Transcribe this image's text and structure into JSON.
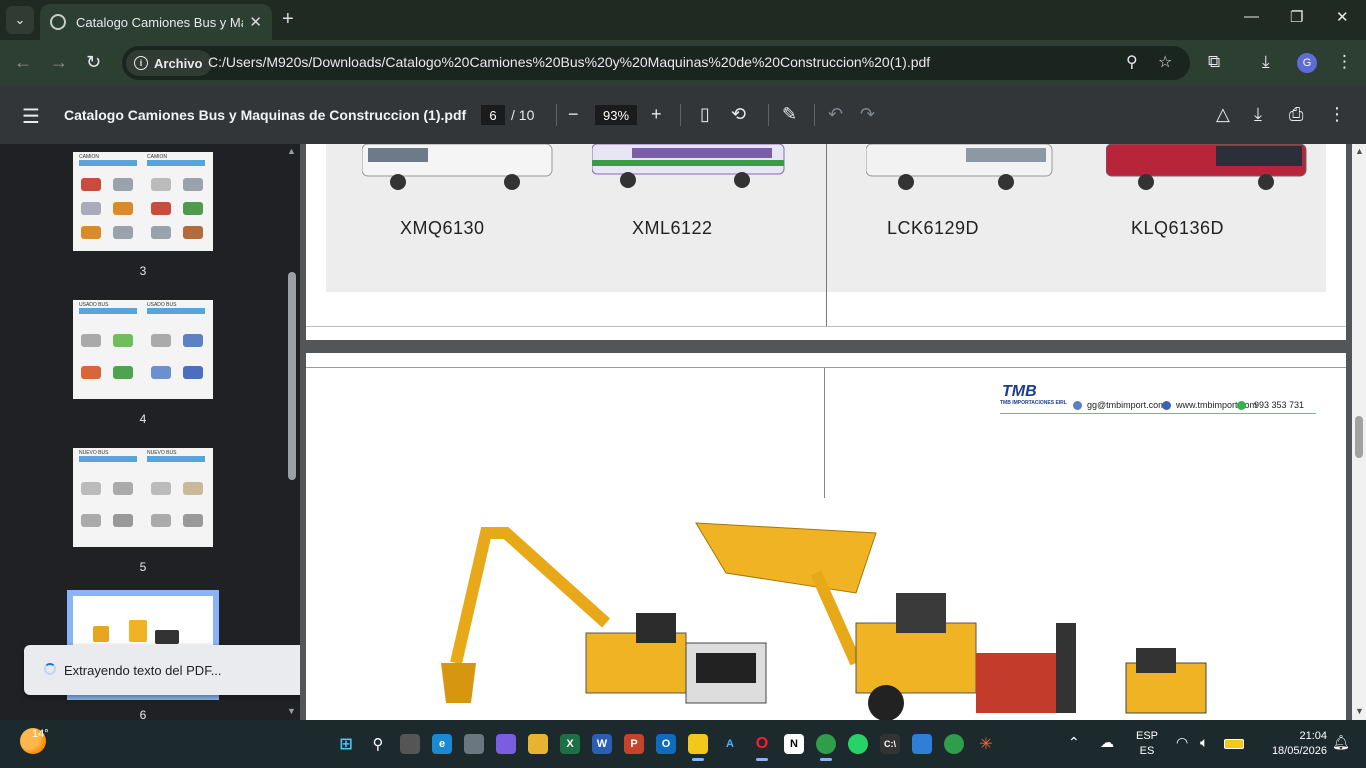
{
  "browser": {
    "tab_title": "Catalogo Camiones Bus y Maquinas de Construccion (1).pdf",
    "tab_title_visible": "Catalogo Camiones Bus y Maqu",
    "new_tab": "+",
    "chip_label": "Archivo",
    "url": "C:/Users/M920s/Downloads/Catalogo%20Camiones%20Bus%20y%20Maquinas%20de%20Construccion%20(1).pdf",
    "profile_initial": "G"
  },
  "pdf_toolbar": {
    "doc_name": "Catalogo Camiones Bus y Maquinas de Construccion (1).pdf",
    "current_page": "6",
    "total_pages": "/ 10",
    "zoom": "93%"
  },
  "sidebar": {
    "thumbnails": [
      {
        "label": "3",
        "header_left": "CAMION",
        "header_right": "CAMION"
      },
      {
        "label": "4",
        "header_left": "USADO BUS",
        "header_right": "USADO BUS"
      },
      {
        "label": "5",
        "header_left": "NUEVO BUS",
        "header_right": "NUEVO BUS"
      },
      {
        "label": "6",
        "selected": true
      }
    ]
  },
  "toast": {
    "message": "Extrayendo texto del PDF..."
  },
  "viewer": {
    "page_top_models": [
      "XMQ6130",
      "XML6122",
      "LCK6129D",
      "KLQ6136D"
    ],
    "page6": {
      "logo": "TMB",
      "logo_sub": "TMB IMPORTACIONES EIRL",
      "email": "gg@tmbimport.com",
      "web": "www.tmbimport.com",
      "phone": "993 353 731"
    }
  },
  "taskbar": {
    "temperature": "14°",
    "lang_top": "ESP",
    "lang_bottom": "ES",
    "time": "21:04",
    "date": "18/05/2026"
  },
  "colors": {
    "tab_bg": "#2d3e33",
    "pdf_toolbar_bg": "#323639",
    "viewer_bg": "#525659",
    "accent_selected": "#8ab4f8"
  }
}
